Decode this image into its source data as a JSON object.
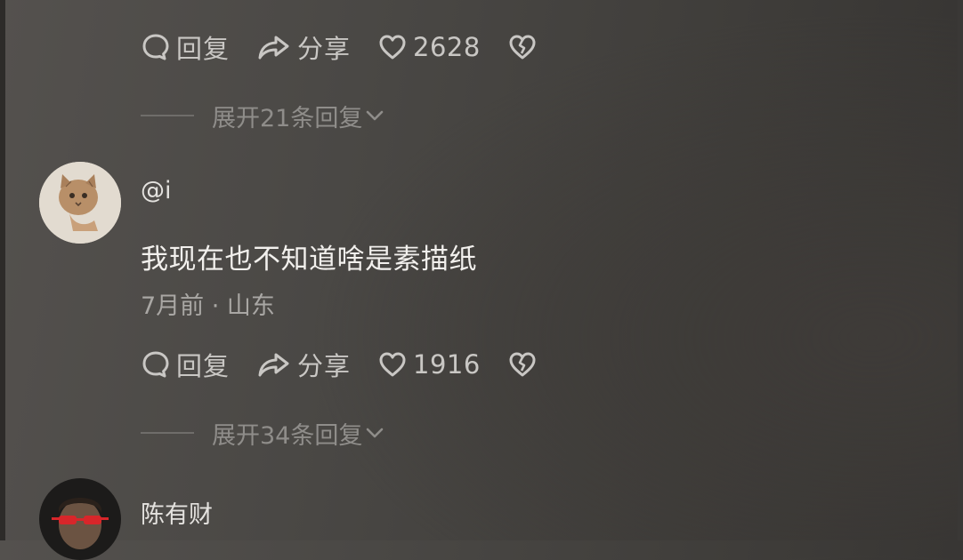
{
  "comments": [
    {
      "actions": {
        "reply_label": "回复",
        "share_label": "分享",
        "like_count": "2628"
      },
      "expand_label": "展开21条回复"
    },
    {
      "username": "@i",
      "text": "我现在也不知道啥是素描纸",
      "meta": "7月前 · 山东",
      "actions": {
        "reply_label": "回复",
        "share_label": "分享",
        "like_count": "1916"
      },
      "expand_label": "展开34条回复"
    },
    {
      "username": "陈有财"
    }
  ],
  "icons": {
    "reply": "comment-bubble-icon",
    "share": "share-arrow-icon",
    "like": "heart-icon",
    "dislike": "broken-heart-icon",
    "expand": "chevron-down-icon"
  },
  "colors": {
    "background": "#4a4845",
    "primary_text": "#f2f0ed",
    "secondary_text": "#a9a7a4",
    "muted_text": "#8f8d8a"
  }
}
